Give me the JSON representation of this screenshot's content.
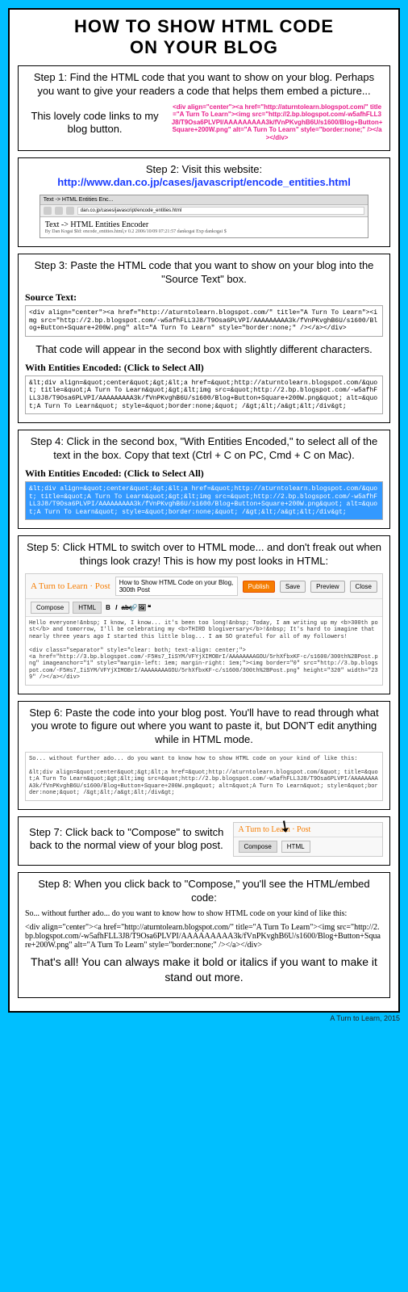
{
  "title_line1": "HOW TO SHOW HTML CODE",
  "title_line2": "ON YOUR BLOG",
  "steps": {
    "s1": {
      "text": "Step 1: Find the HTML code that you want to show on your blog.  Perhaps you want to give your readers a code that helps them embed a picture...",
      "caption": "This lovely code links to my blog button.",
      "code": "<div align=\"center\"><a href=\"http://aturntolearn.blogspot.com/\" title=\"A Turn To Learn\"><img src=\"http://2.bp.blogspot.com/-w5afhFLL3J8/T9Osa6PLVPI/AAAAAAAAA3k/fVnPKvghB6U/s1600/Blog+Button+Square+200W.png\" alt=\"A Turn To Learn\" style=\"border:none;\" /></a></div>"
    },
    "s2": {
      "text": "Step 2: Visit this website: ",
      "url": "http://www.dan.co.jp/cases/javascript/encode_entities.html",
      "browser_tab": "Text -> HTML Entities Enc...",
      "browser_title": "Text -> HTML Entities Encoder",
      "browser_sub": "By Dan Kogai $Id: encode_entities.html,v 0.2 2006/10/09 07:21:57 dankogai Exp dankogai $"
    },
    "s3": {
      "text": "Step 3: Paste the HTML code that you want to show on your blog into the \"Source Text\" box.",
      "label": "Source Text:",
      "box": "<div align=\"center\"><a href=\"http://aturntolearn.blogspot.com/\" title=\"A Turn To Learn\"><img src=\"http://2.bp.blogspot.com/-w5afhFLL3J8/T9Osa6PLVPI/AAAAAAAAA3k/fVnPKvghB6U/s1600/Blog+Button+Square+200W.png\" alt=\"A Turn To Learn\" style=\"border:none;\" /></a></div>",
      "mid_text": "That code will appear in the second box with slightly different characters.",
      "label2": "With Entities Encoded: (Click to Select All)",
      "box2": "&lt;div align=&quot;center&quot;&gt;&lt;a href=&quot;http://aturntolearn.blogspot.com/&quot; title=&quot;A Turn To Learn&quot;&gt;&lt;img src=&quot;http://2.bp.blogspot.com/-w5afhFLL3J8/T9Osa6PLVPI/AAAAAAAAA3k/fVnPKvghB6U/s1600/Blog+Button+Square+200W.png&quot; alt=&quot;A Turn To Learn&quot; style=&quot;border:none;&quot; /&gt;&lt;/a&gt;&lt;/div&gt;"
    },
    "s4": {
      "text": "Step 4: Click in the second box, \"With Entities Encoded,\" to select all of the text in the box. Copy that text (Ctrl + C on PC, Cmd + C on Mac).",
      "label": "With Entities Encoded: (Click to Select All)",
      "box": "&lt;div align=&quot;center&quot;&gt;&lt;a href=&quot;http://aturntolearn.blogspot.com/&quot; title=&quot;A Turn To Learn&quot;&gt;&lt;img src=&quot;http://2.bp.blogspot.com/-w5afhFLL3J8/T9Osa6PLVPI/AAAAAAAAA3k/fVnPKvghB6U/s1600/Blog+Button+Square+200W.png&quot; alt=&quot;A Turn To Learn&quot; style=&quot;border:none;&quot; /&gt;&lt;/a&gt;&lt;/div&gt;"
    },
    "s5": {
      "text": "Step 5: Click HTML to switch over to HTML mode... and don't freak out when things look crazy! This is how my post looks in HTML:",
      "blogger_logo": "A Turn to Learn · Post",
      "post_title": "How to Show HTML Code on your Blog, 300th Post",
      "btn_publish": "Publish",
      "btn_save": "Save",
      "btn_preview": "Preview",
      "btn_close": "Close",
      "tab_compose": "Compose",
      "tab_html": "HTML",
      "body": "Hello everyone!&nbsp; I know, I know... it's been too long!&nbsp; Today, I am writing up my <b>300th post</b> and tomorrow, I'll be celebrating my <b>THIRD blogiversary</b>!&nbsp; It's hard to imagine that nearly three years ago I started this little blog... I am SO grateful for all of my followers!\n\n<div class=\"separator\" style=\"clear: both; text-align: center;\">\n<a href=\"http://3.bp.blogspot.com/-F5Hs7_IiSYM/VFYjXIMOBrI/AAAAAAAAGOU/5rhXfbxKF-c/s1600/300th%2BPost.png\" imageanchor=\"1\" style=\"margin-left: 1em; margin-right: 1em;\"><img border=\"0\" src=\"http://3.bp.blogspot.com/-F5Hs7_IiSYM/VFYjXIMOBrI/AAAAAAAAGOU/5rhXfbxKF-c/s1600/300th%2BPost.png\" height=\"320\" width=\"239\" /></a></div>"
    },
    "s6": {
      "text": "Step 6: Paste the code into your blog post.  You'll have to read through what you wrote to figure out where you want to paste it, but DON'T edit anything while in HTML mode.",
      "body": "So... without further ado... do you want to know how to show HTML code on your kind of like this:\n\n&lt;div align=&quot;center&quot;&gt;&lt;a href=&quot;http://aturntolearn.blogspot.com/&quot; title=&quot;A Turn To Learn&quot;&gt;&lt;img src=&quot;http://2.bp.blogspot.com/-w5afhFLL3J8/T9Osa6PLVPI/AAAAAAAAA3k/fVnPKvghB6U/s1600/Blog+Button+Square+200W.png&quot; alt=&quot;A Turn To Learn&quot; style=&quot;border:none;&quot; /&gt;&lt;/a&gt;&lt;/div&gt;"
    },
    "s7": {
      "text": "Step 7: Click back to \"Compose\" to switch back to the normal view of your blog post.",
      "logo": "A Turn to Learn · Post",
      "tab_compose": "Compose",
      "tab_html": "HTML"
    },
    "s8": {
      "text": "Step 8: When you click back to \"Compose,\" you'll see the HTML/embed code:",
      "intro": "So... without further ado... do you want to know how to show HTML code on your kind of like this:",
      "code": "<div align=\"center\"><a href=\"http://aturntolearn.blogspot.com/\" title=\"A Turn To Learn\"><img src=\"http://2.bp.blogspot.com/-w5afhFLL3J8/T9Osa6PLVPI/AAAAAAAAA3k/fVnPKvghB6U/s1600/Blog+Button+Square+200W.png\" alt=\"A Turn To Learn\" style=\"border:none;\" /></a></div>",
      "outro": "That's all! You can always make it bold or italics if you want to make it stand out more."
    }
  },
  "footer": "A Turn to Learn, 2015"
}
